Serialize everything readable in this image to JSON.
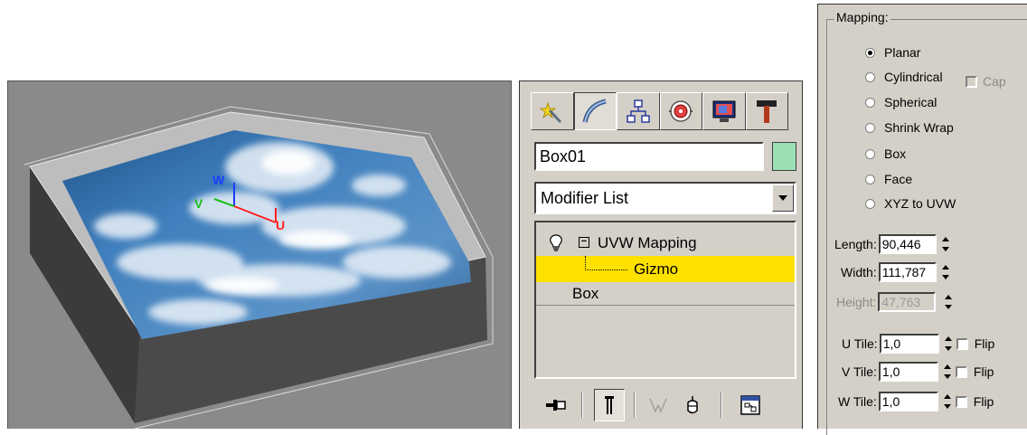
{
  "command_panel": {
    "tabs": [
      "create-tab",
      "modify-tab",
      "hierarchy-tab",
      "motion-tab",
      "display-tab",
      "utilities-tab"
    ],
    "object_name": "Box01",
    "object_color": "#9cdfb5",
    "modifier_list_label": "Modifier List",
    "stack": {
      "modifier": "UVW Mapping",
      "sub_object": "Gizmo",
      "base_object": "Box",
      "highlight_color": "#ffe100"
    }
  },
  "viewport": {
    "background": "#8a8a8a",
    "gizmo_axes": [
      "W",
      "V",
      "U"
    ]
  },
  "mapping": {
    "group_title": "Mapping:",
    "types": [
      {
        "label": "Planar",
        "selected": true
      },
      {
        "label": "Cylindrical",
        "selected": false
      },
      {
        "label": "Spherical",
        "selected": false
      },
      {
        "label": "Shrink Wrap",
        "selected": false
      },
      {
        "label": "Box",
        "selected": false
      },
      {
        "label": "Face",
        "selected": false
      },
      {
        "label": "XYZ to UVW",
        "selected": false
      }
    ],
    "cap_label": "Cap",
    "length_label": "Length:",
    "length_value": "90,446",
    "width_label": "Width:",
    "width_value": "111,787",
    "height_label": "Height:",
    "height_value": "47,763",
    "u_tile_label": "U Tile:",
    "u_tile_value": "1,0",
    "v_tile_label": "V Tile:",
    "v_tile_value": "1,0",
    "w_tile_label": "W Tile:",
    "w_tile_value": "1,0",
    "flip_label": "Flip"
  }
}
